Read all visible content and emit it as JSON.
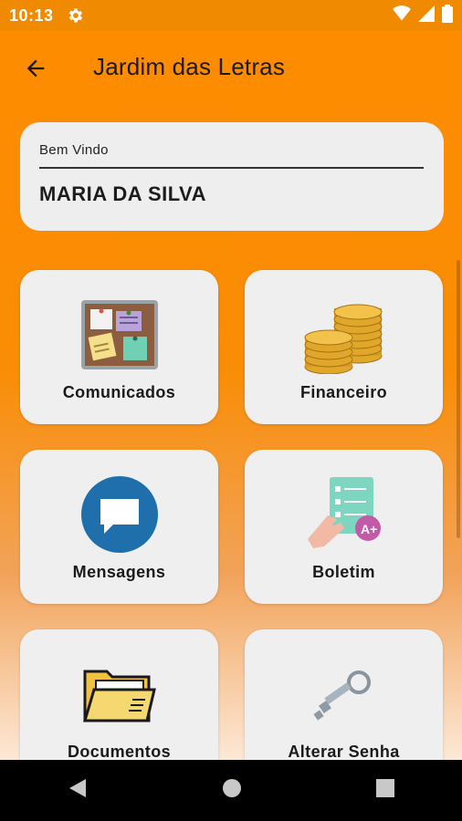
{
  "status_bar": {
    "time": "10:13"
  },
  "app_bar": {
    "title": "Jardim das Letras"
  },
  "welcome": {
    "label": "Bem Vindo",
    "name": "MARIA DA SILVA"
  },
  "tiles": [
    {
      "label": "Comunicados"
    },
    {
      "label": "Financeiro"
    },
    {
      "label": "Mensagens"
    },
    {
      "label": "Boletim"
    },
    {
      "label": "Documentos"
    },
    {
      "label": "Alterar Senha"
    }
  ],
  "colors": {
    "primary": "#ff8c00",
    "card": "#efefef"
  },
  "icons": {
    "status": [
      "gear-icon",
      "wifi-icon",
      "signal-icon",
      "battery-icon"
    ],
    "nav": [
      "back-triangle-icon",
      "home-circle-icon",
      "recents-square-icon"
    ]
  }
}
